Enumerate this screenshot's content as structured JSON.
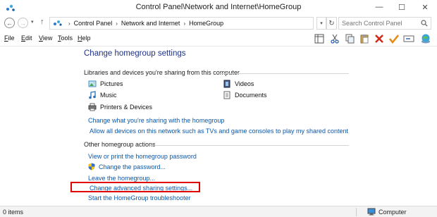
{
  "window": {
    "title": "Control Panel\\Network and Internet\\HomeGroup",
    "minimize_glyph": "—",
    "maximize_glyph": "☐",
    "close_glyph": "✕"
  },
  "nav": {
    "back_glyph": "←",
    "forward_glyph": "→",
    "dropdown_glyph": "▾",
    "up_glyph": "↑",
    "breadcrumbs": [
      "Control Panel",
      "Network and Internet",
      "HomeGroup"
    ],
    "crumb_separator": "›",
    "refresh_glyph": "↻",
    "search_placeholder": "Search Control Panel"
  },
  "menu": {
    "items": [
      {
        "key": "F",
        "rest": "ile"
      },
      {
        "key": "E",
        "rest": "dit"
      },
      {
        "key": "V",
        "rest": "iew"
      },
      {
        "key": "T",
        "rest": "ools"
      },
      {
        "key": "H",
        "rest": "elp"
      }
    ]
  },
  "toolbar": {
    "icons": [
      "layout-pane-icon",
      "cut-icon",
      "copy-icon",
      "paste-icon",
      "delete-icon",
      "checkmark-icon",
      "rename-icon",
      "globe-icon"
    ]
  },
  "main": {
    "title": "Change homegroup settings",
    "libraries_heading": "Libraries and devices you're sharing from this computer",
    "libraries": [
      {
        "label": "Pictures",
        "icon": "pictures-icon"
      },
      {
        "label": "Videos",
        "icon": "videos-icon"
      },
      {
        "label": "Music",
        "icon": "music-icon"
      },
      {
        "label": "Documents",
        "icon": "documents-icon"
      },
      {
        "label": "Printers & Devices",
        "icon": "printer-icon"
      }
    ],
    "change_sharing_link": "Change what you're sharing with the homegroup",
    "allow_devices_link": "Allow all devices on this network such as TVs and game consoles to play my shared content",
    "actions_heading": "Other homegroup actions",
    "actions": [
      "View or print the homegroup password",
      "Change the password...",
      "Leave the homegroup...",
      "Change advanced sharing settings...",
      "Start the HomeGroup troubleshooter"
    ]
  },
  "status": {
    "items": "0 items",
    "location": "Computer"
  },
  "colors": {
    "link": "#0b57a8",
    "title": "#1e3287",
    "highlight": "#e00000"
  }
}
